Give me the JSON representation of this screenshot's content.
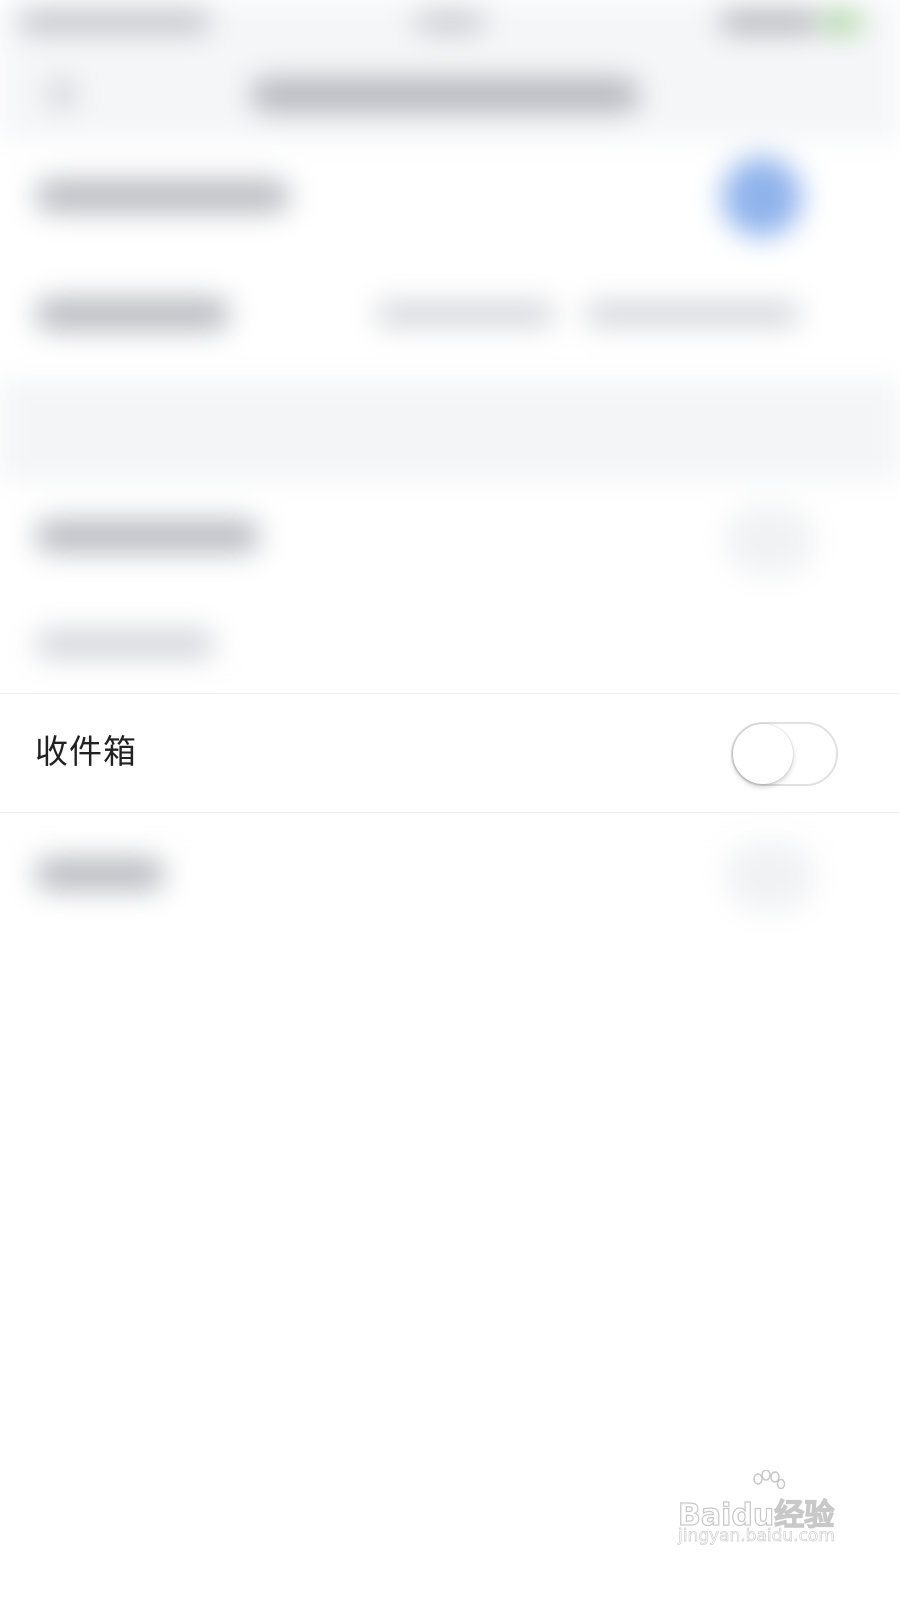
{
  "focused_row": {
    "label": "收件箱",
    "toggle_on": false
  },
  "watermark": {
    "main": "Baidu经验",
    "sub": "jingyan.baidu.com"
  },
  "colors": {
    "accent_blurred": "#8fb3ec",
    "background": "#ffffff",
    "section_gap": "#f4f5f7",
    "label_text": "#222222"
  }
}
